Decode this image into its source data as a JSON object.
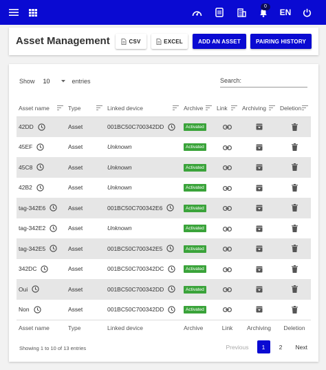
{
  "topbar": {
    "notification_count": "0",
    "language": "EN",
    "icons": [
      "menu-icon",
      "grid-icon",
      "gauge-icon",
      "scanner-icon",
      "building-icon",
      "bell-icon",
      "power-icon"
    ],
    "bg_color": "#0a0ad2"
  },
  "header": {
    "title": "Asset Management",
    "csv_label": "CSV",
    "excel_label": "EXCEL",
    "add_label": "ADD AN ASSET",
    "pairing_label": "PAIRING HISTORY"
  },
  "table_controls": {
    "show_label": "Show",
    "entries_value": "10",
    "entries_label": "entries",
    "search_placeholder": "Search:"
  },
  "columns": [
    "Asset name",
    "Type",
    "Linked device",
    "Archive",
    "Link",
    "Archiving",
    "Deletion"
  ],
  "rows": [
    {
      "name": "42DD",
      "type": "Asset",
      "device": "001BC50C700342DD",
      "archive": "Activated",
      "has_clock": true
    },
    {
      "name": "45EF",
      "type": "Asset",
      "device": "Unknown",
      "archive": "Activated",
      "has_clock": false
    },
    {
      "name": "45C8",
      "type": "Asset",
      "device": "Unknown",
      "archive": "Activated",
      "has_clock": false
    },
    {
      "name": "42B2",
      "type": "Asset",
      "device": "Unknown",
      "archive": "Activated",
      "has_clock": false
    },
    {
      "name": "tag-342E6",
      "type": "Asset",
      "device": "001BC50C700342E6",
      "archive": "Activated",
      "has_clock": true
    },
    {
      "name": "tag-342E2",
      "type": "Asset",
      "device": "Unknown",
      "archive": "Activated",
      "has_clock": false
    },
    {
      "name": "tag-342E5",
      "type": "Asset",
      "device": "001BC50C700342E5",
      "archive": "Activated",
      "has_clock": true
    },
    {
      "name": "342DC",
      "type": "Asset",
      "device": "001BC50C700342DC",
      "archive": "Activated",
      "has_clock": true
    },
    {
      "name": "Oui",
      "type": "Asset",
      "device": "001BC50C700342DD",
      "archive": "Activated",
      "has_clock": true
    },
    {
      "name": "Non",
      "type": "Asset",
      "device": "001BC50C700342DD",
      "archive": "Activated",
      "has_clock": true
    }
  ],
  "footer": {
    "info": "Showing 1 to 10 of 13 entries",
    "previous": "Previous",
    "pages": [
      "1",
      "2"
    ],
    "next": "Next",
    "active_page": "1"
  },
  "colors": {
    "accent": "#0a0ad2",
    "badge": "#3aa33a",
    "striped_row": "#e6e6e6"
  }
}
